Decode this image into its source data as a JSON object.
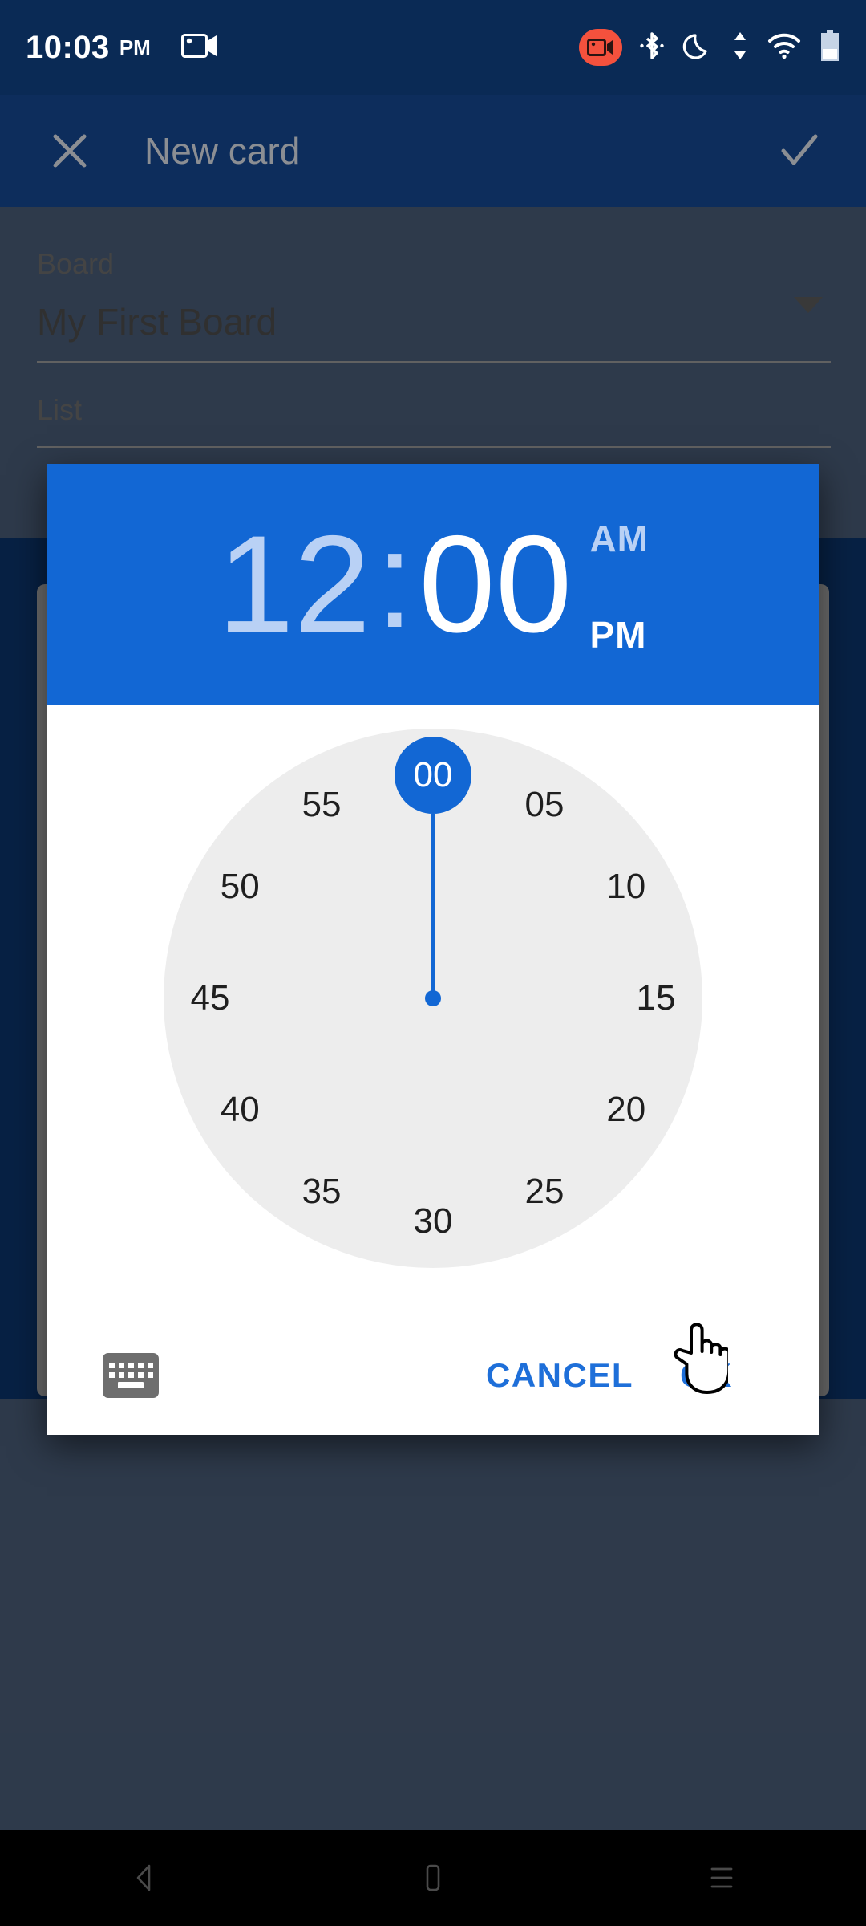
{
  "status_bar": {
    "time": "10:03",
    "time_period": "PM",
    "icons": [
      "screen-record-icon",
      "bluetooth-icon",
      "do-not-disturb-moon-icon",
      "data-transfer-icon",
      "wifi-icon",
      "battery-icon"
    ],
    "record_badge_color": "#f4513d"
  },
  "app_bar": {
    "close_label": "✕",
    "title": "New card",
    "confirm_label": "✓",
    "background": "#0d2d5c",
    "title_color": "#8b8e93"
  },
  "form": {
    "fields": [
      {
        "label": "Board",
        "value": "My First Board",
        "has_dropdown": true
      },
      {
        "label": "List",
        "value": "",
        "has_dropdown": false
      }
    ]
  },
  "dialog": {
    "accent": "#1267d4",
    "header": {
      "hour": "12",
      "colon": ":",
      "minute": "00",
      "am_label": "AM",
      "pm_label": "PM",
      "selected_segment": "minute",
      "selected_period": "PM"
    },
    "clock": {
      "mode": "minutes",
      "selected_value": "00",
      "face_color": "#ededed",
      "ticks": [
        "00",
        "05",
        "10",
        "15",
        "20",
        "25",
        "30",
        "35",
        "40",
        "45",
        "50",
        "55"
      ]
    },
    "footer": {
      "keyboard_icon": "keyboard-icon",
      "cancel_label": "CANCEL",
      "ok_label": "OK",
      "button_color": "#1e6fd9"
    }
  },
  "nav_bar": {
    "back_label": "back-icon",
    "home_label": "home-icon",
    "recents_label": "recents-icon"
  }
}
